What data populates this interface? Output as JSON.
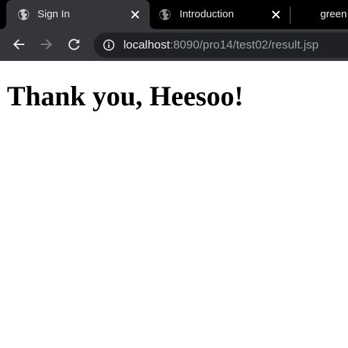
{
  "tabs": [
    {
      "title": "Sign In",
      "active": true,
      "favicon": "globe-icon"
    },
    {
      "title": "Introduction",
      "active": false,
      "favicon": "globe-icon"
    },
    {
      "title": "green",
      "active": false
    }
  ],
  "toolbar": {
    "back_icon": "back-arrow-icon",
    "forward_icon": "forward-arrow-icon",
    "reload_icon": "reload-icon",
    "info_icon": "info-icon",
    "url_host": "localhost",
    "url_path": ":8090/pro14/test02/result.jsp"
  },
  "page": {
    "heading": "Thank you, Heesoo!"
  },
  "colors": {
    "tabstrip_bg": "#000000",
    "active_tab_bg": "#35363a",
    "omnibox_bg": "#202124",
    "text_light": "#e8eaed",
    "text_muted": "#9aa0a6",
    "page_bg": "#ffffff"
  }
}
